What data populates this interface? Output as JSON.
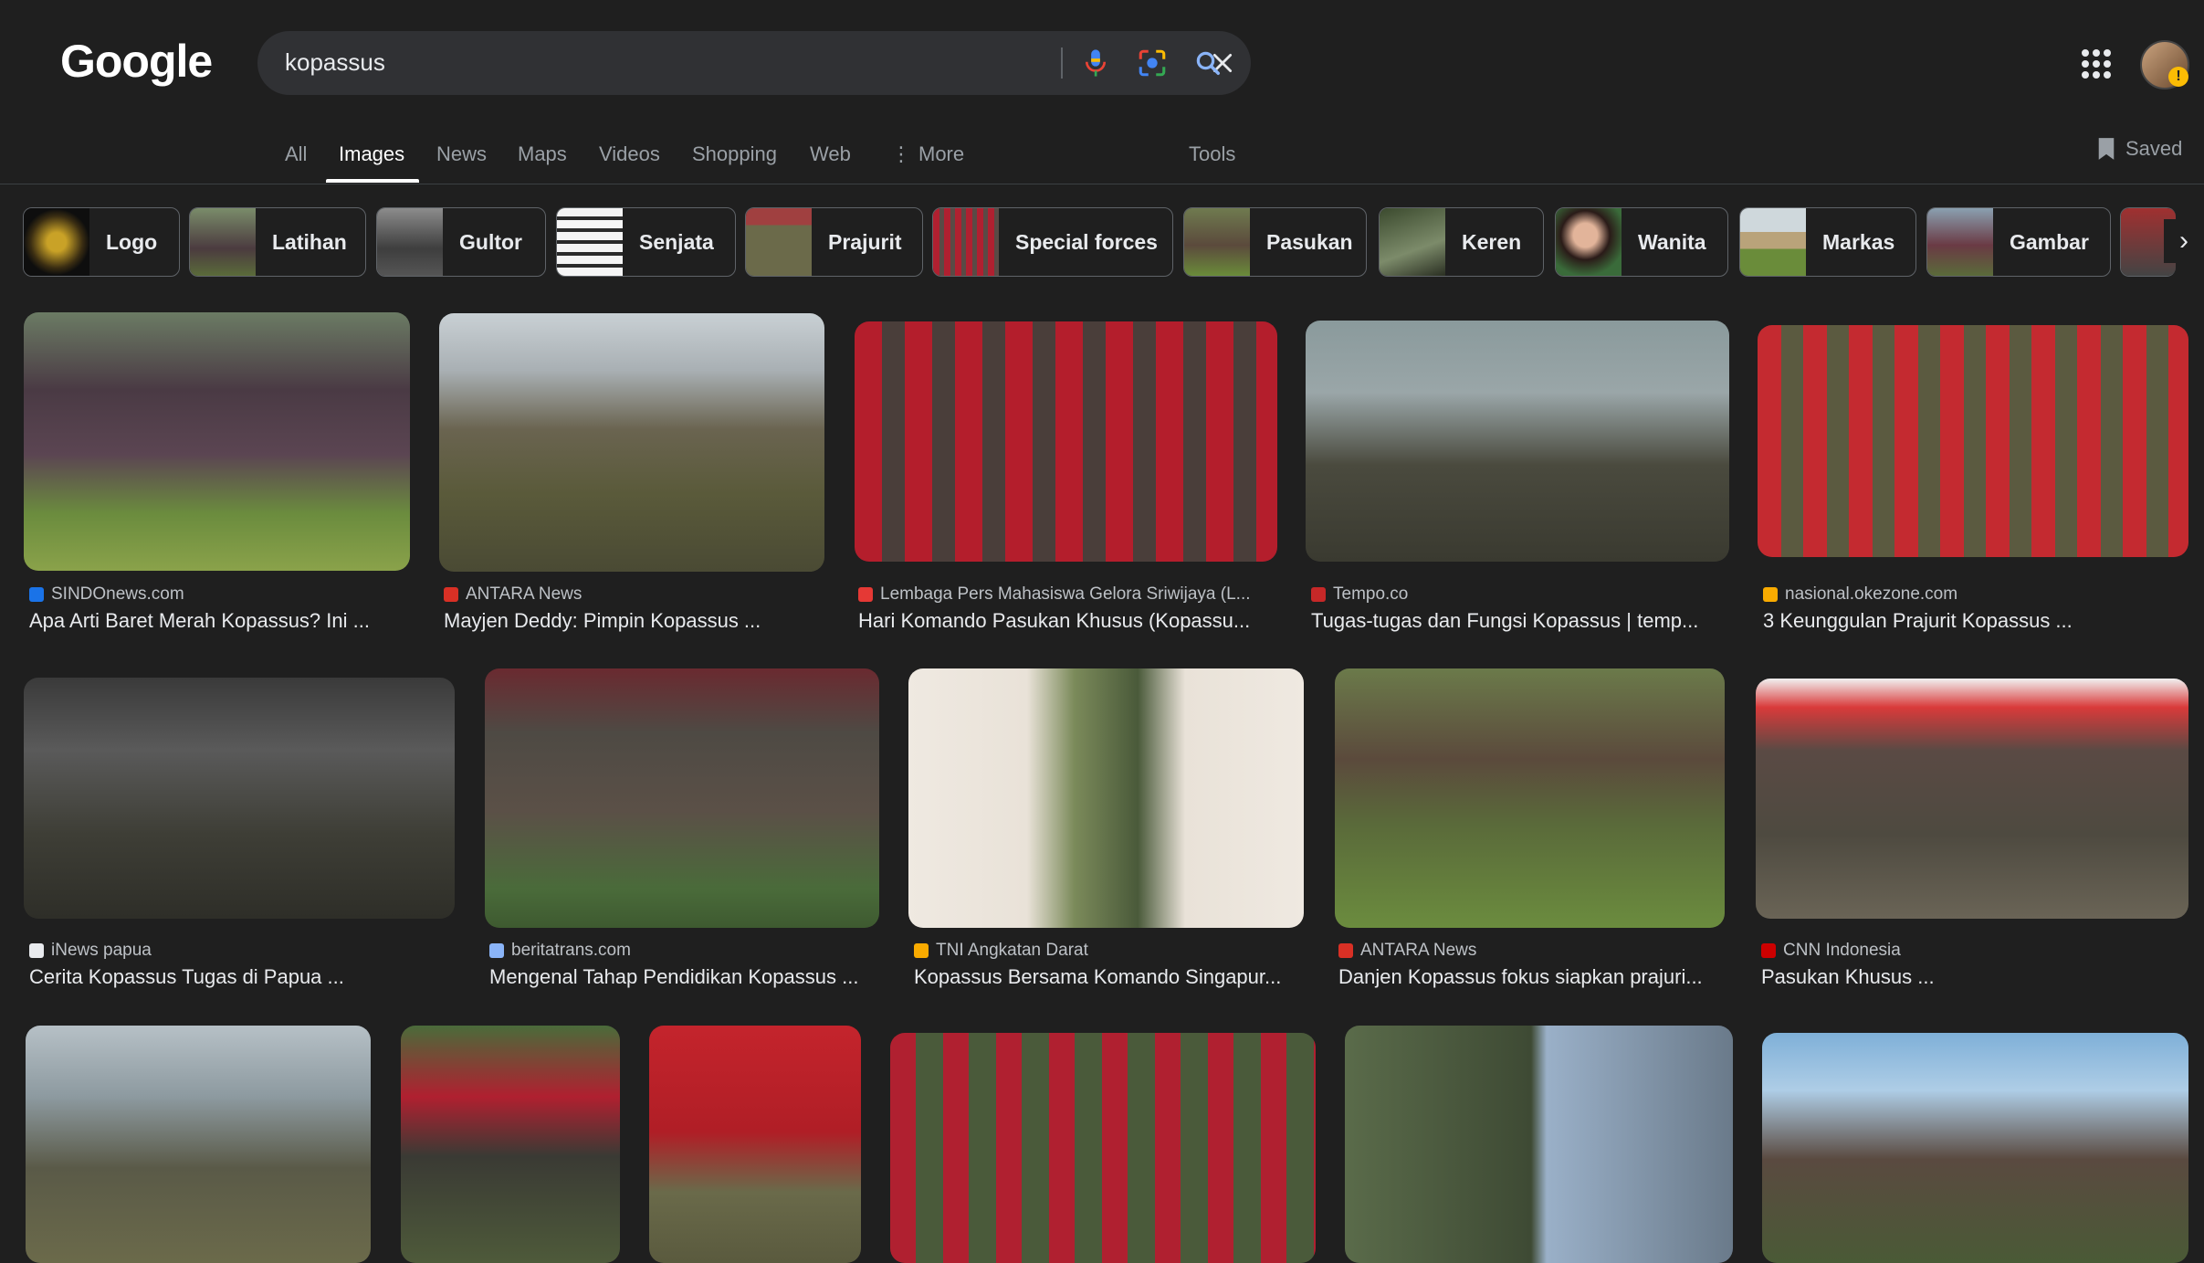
{
  "header": {
    "logo": "Google",
    "query": "kopassus",
    "avatar_badge": "!"
  },
  "tabs": [
    {
      "label": "All"
    },
    {
      "label": "Images"
    },
    {
      "label": "News"
    },
    {
      "label": "Maps"
    },
    {
      "label": "Videos"
    },
    {
      "label": "Shopping"
    },
    {
      "label": "Web"
    },
    {
      "label": "More"
    },
    {
      "label": "Tools"
    }
  ],
  "saved_label": "Saved",
  "chips": [
    {
      "label": "Logo"
    },
    {
      "label": "Latihan"
    },
    {
      "label": "Gultor"
    },
    {
      "label": "Senjata"
    },
    {
      "label": "Prajurit"
    },
    {
      "label": "Special forces"
    },
    {
      "label": "Pasukan"
    },
    {
      "label": "Keren"
    },
    {
      "label": "Wanita"
    },
    {
      "label": "Markas"
    },
    {
      "label": "Gambar"
    }
  ],
  "results": [
    {
      "source": "SINDOnews.com",
      "title": "Apa Arti Baret Merah Kopassus? Ini ...",
      "favicon_color": "#1a73e8"
    },
    {
      "source": "ANTARA News",
      "title": "Mayjen Deddy: Pimpin Kopassus ...",
      "favicon_color": "#d93025"
    },
    {
      "source": "Lembaga Pers Mahasiswa Gelora Sriwijaya (L...",
      "title": "Hari Komando Pasukan Khusus (Kopassu...",
      "favicon_color": "#e53935"
    },
    {
      "source": "Tempo.co",
      "title": "Tugas-tugas dan Fungsi Kopassus | temp...",
      "favicon_color": "#c62828"
    },
    {
      "source": "nasional.okezone.com",
      "title": "3 Keunggulan Prajurit Kopassus ...",
      "favicon_color": "#f9ab00"
    },
    {
      "source": "iNews papua",
      "title": "Cerita Kopassus Tugas di Papua ...",
      "favicon_color": "#e8eaed"
    },
    {
      "source": "beritatrans.com",
      "title": "Mengenal Tahap Pendidikan Kopassus ...",
      "favicon_color": "#8ab4f8"
    },
    {
      "source": "TNI Angkatan Darat",
      "title": "Kopassus Bersama Komando Singapur...",
      "favicon_color": "#f9ab00"
    },
    {
      "source": "ANTARA News",
      "title": "Danjen Kopassus fokus siapkan prajuri...",
      "favicon_color": "#d93025"
    },
    {
      "source": "CNN Indonesia",
      "title": "Pasukan Khusus ...",
      "favicon_color": "#cc0000"
    }
  ],
  "colors": {
    "background": "#1f1f1f",
    "search_bg": "#303134",
    "text": "#e8eaed",
    "muted": "#9aa0a6"
  }
}
